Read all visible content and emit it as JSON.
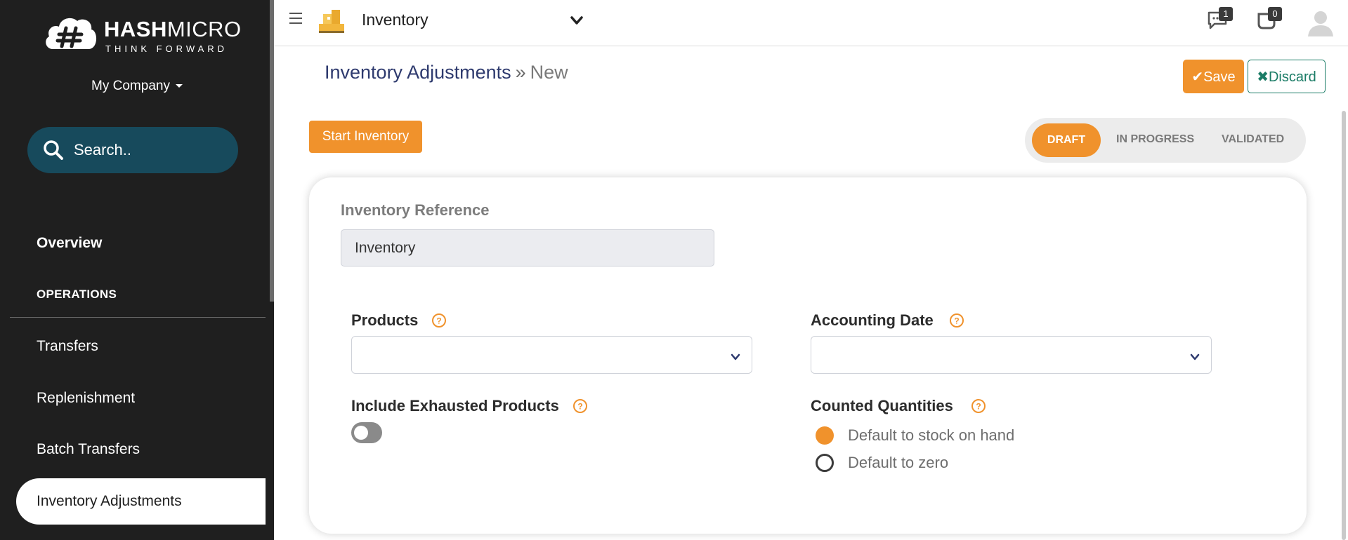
{
  "sidebar": {
    "brand_main_bold": "HASH",
    "brand_main_light": "MICRO",
    "brand_sub": "THINK FORWARD",
    "company": "My Company",
    "search_placeholder": "Search..",
    "overview": "Overview",
    "section": "OPERATIONS",
    "items": [
      "Transfers",
      "Replenishment",
      "Batch Transfers",
      "Inventory Adjustments"
    ]
  },
  "topbar": {
    "app_title": "Inventory",
    "messages_count": "1",
    "activities_count": "0"
  },
  "breadcrumb": {
    "parent": "Inventory Adjustments",
    "separator": "»",
    "current": "New"
  },
  "actions": {
    "save": "Save",
    "discard": "Discard",
    "start": "Start Inventory"
  },
  "status": {
    "draft": "DRAFT",
    "in_progress": "IN PROGRESS",
    "validated": "VALIDATED",
    "active": "DRAFT"
  },
  "form": {
    "reference_label": "Inventory Reference",
    "reference_value": "Inventory",
    "products_label": "Products",
    "products_value": "",
    "accounting_date_label": "Accounting Date",
    "accounting_date_value": "",
    "include_exhausted_label": "Include Exhausted Products",
    "include_exhausted_on": false,
    "counted_quantities_label": "Counted Quantities",
    "counted_options": [
      "Default to stock on hand",
      "Default to zero"
    ],
    "counted_selected": "Default to stock on hand"
  },
  "colors": {
    "accent": "#f0922c",
    "sidebar_bg": "#1f1f1f",
    "search_bg": "#174a5c",
    "discard": "#1b7c66",
    "breadcrumb": "#2e3a6e"
  },
  "icons": {
    "menu": "hamburger-icon",
    "app": "inventory-boxes-icon",
    "messages": "chat-icon",
    "activities": "activity-icon",
    "help": "question-circle-icon"
  }
}
